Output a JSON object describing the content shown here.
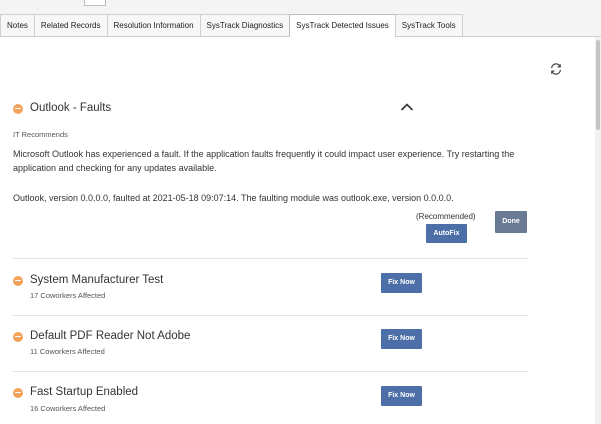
{
  "tabs": [
    {
      "label": "Notes"
    },
    {
      "label": "Related Records"
    },
    {
      "label": "Resolution Information"
    },
    {
      "label": "SysTrack Diagnostics"
    },
    {
      "label": "SysTrack Detected Issues",
      "active": true
    },
    {
      "label": "SysTrack Tools"
    }
  ],
  "toolbar": {
    "refresh_icon": "refresh-icon"
  },
  "expanded_issue": {
    "title": "Outlook - Faults",
    "section_label": "IT Recommends",
    "recommendation": "Microsoft Outlook has experienced a fault. If the application faults frequently it could impact user experience. Try restarting the application and checking for any updates available.",
    "details": "Outlook, version 0.0.0.0, faulted at 2021-05-18 09:07:14. The faulting module was outlook.exe, version 0.0.0.0.",
    "recommended_label": "(Recommended)",
    "autofix_label": "AutoFix",
    "done_label": "Done"
  },
  "issues": [
    {
      "title": "System Manufacturer Test",
      "affected": "17 Coworkers Affected",
      "action": "Fix Now"
    },
    {
      "title": "Default PDF Reader Not Adobe",
      "affected": "11 Coworkers Affected",
      "action": "Fix Now"
    },
    {
      "title": "Fast Startup Enabled",
      "affected": "16 Coworkers Affected",
      "action": "Fix Now"
    }
  ],
  "colors": {
    "status_dot": "#f3a35b",
    "primary_button": "#4b6fa6",
    "secondary_button": "#6a7a93"
  }
}
